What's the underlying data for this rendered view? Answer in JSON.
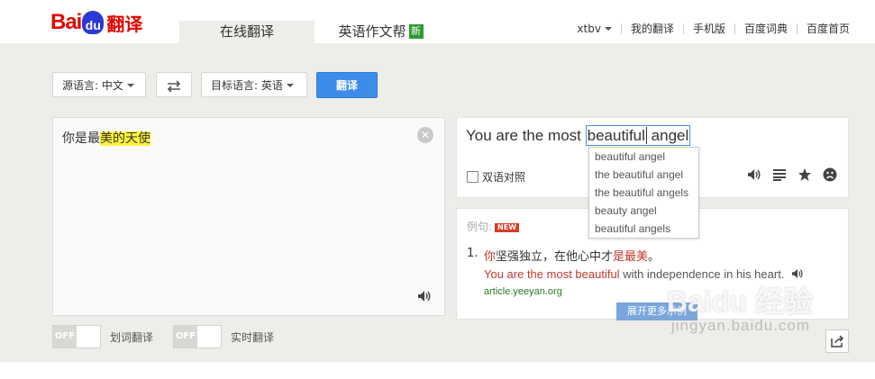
{
  "logo": {
    "bai": "Bai",
    "du": "du",
    "fanyi": "翻译"
  },
  "tabs": [
    {
      "label": "在线翻译",
      "active": true
    },
    {
      "label": "英语作文帮",
      "badge": "新"
    }
  ],
  "topnav": {
    "user": "xtbv",
    "links": [
      "我的翻译",
      "手机版",
      "百度词典",
      "百度首页"
    ]
  },
  "toolbar": {
    "source_lang": "源语言: 中文",
    "target_lang": "目标语言: 英语",
    "translate_label": "翻译"
  },
  "input": {
    "text_plain": "你是最",
    "text_highlight": "美的天使"
  },
  "output": {
    "prefix": "You are the most",
    "word1": "beautiful",
    "word2": "angel",
    "bilingual_label": "双语对照"
  },
  "suggestions": [
    "beautiful angel",
    "the beautiful angel",
    "the beautiful angels",
    "beauty angel",
    "beautiful angels"
  ],
  "examples": {
    "label": "例句:",
    "new_tag": "NEW",
    "items": [
      {
        "num": "1.",
        "zh_a": "你",
        "zh_b": "坚强独立，在他心中才",
        "zh_c": "是最美",
        "zh_d": "。",
        "en_red": "You are the most beautiful",
        "en_rest": " with independence in his heart.",
        "source": "article.yeeyan.org"
      }
    ],
    "more_label": "展开更多示例"
  },
  "toggles": [
    {
      "state": "OFF",
      "label": "划词翻译"
    },
    {
      "state": "OFF",
      "label": "实时翻译"
    }
  ],
  "watermark": {
    "main": "Baidu 经验",
    "url": "jingyan.baidu.com"
  },
  "colors": {
    "accent": "#3d8de8",
    "brand_red": "#e10602",
    "highlight": "#fff23a",
    "example_red": "#c0392b"
  }
}
